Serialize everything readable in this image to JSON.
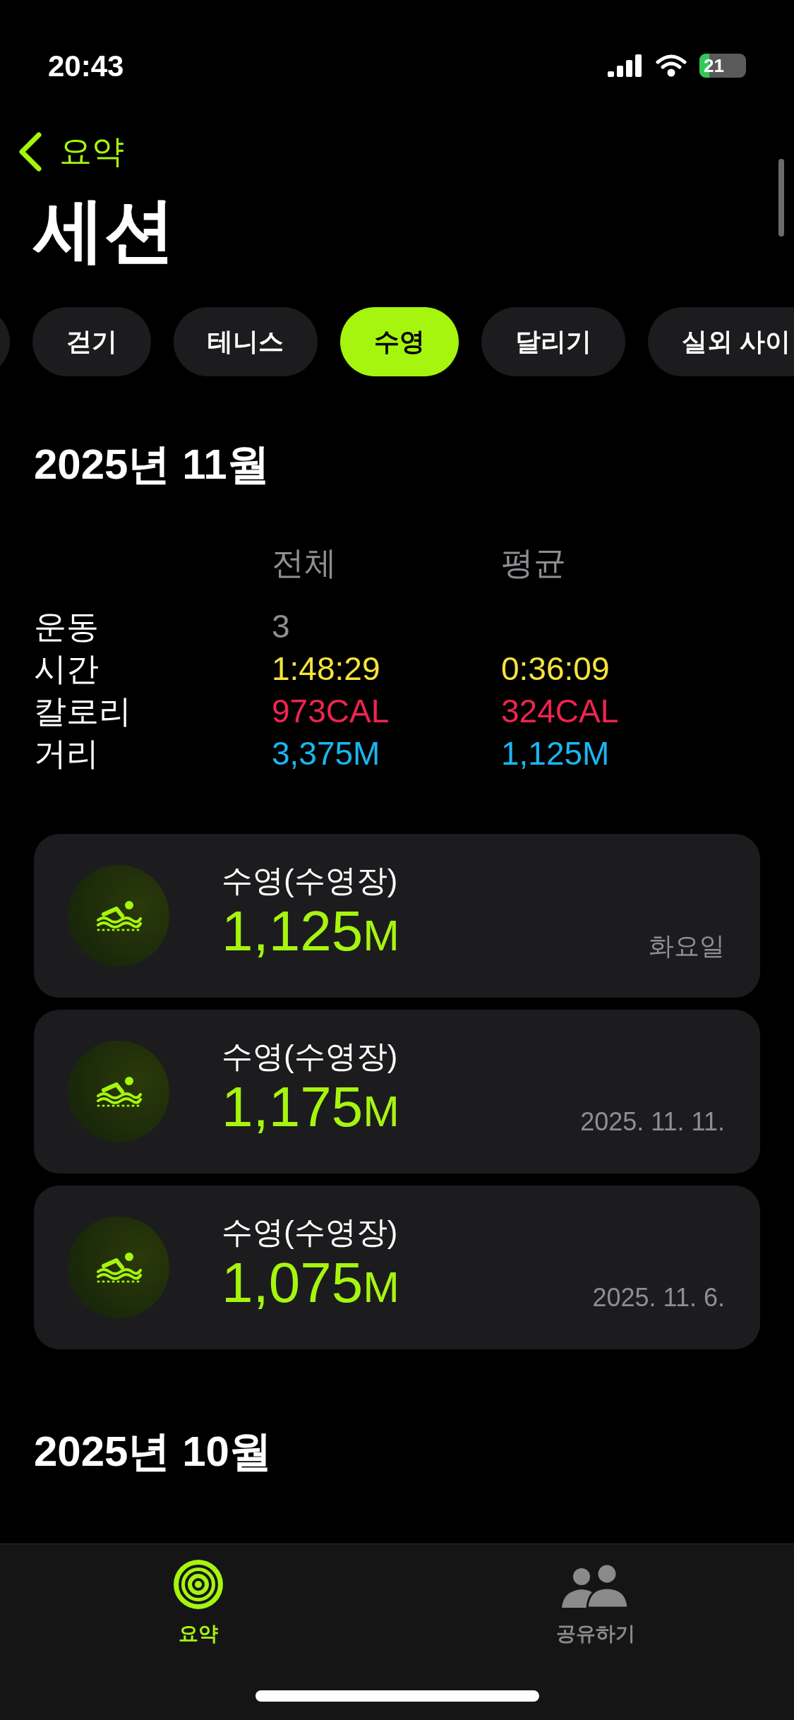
{
  "status_bar": {
    "time": "20:43",
    "battery": "21"
  },
  "nav": {
    "back_label": "요약",
    "title": "세션"
  },
  "filters": [
    {
      "selected": false
    },
    {
      "label": "걷기",
      "selected": false
    },
    {
      "label": "테니스",
      "selected": false
    },
    {
      "label": "수영",
      "selected": true
    },
    {
      "label": "달리기",
      "selected": false
    },
    {
      "label": "실외 사이",
      "selected": false
    }
  ],
  "sections": [
    {
      "title": "2025년 11월",
      "columns": [
        "전체",
        "평균"
      ],
      "rows": [
        {
          "label": "운동",
          "total": "3",
          "color": "#8e8e93"
        },
        {
          "label": "시간",
          "total": "1:48:29",
          "average": "0:36:09",
          "color": "#f5e33b"
        },
        {
          "label": "칼로리",
          "total": "973CAL",
          "average": "324CAL",
          "color": "#f0244f"
        },
        {
          "label": "거리",
          "total": "3,375M",
          "average": "1,125M",
          "color": "#1ab7f0"
        }
      ],
      "workouts": [
        {
          "title": "수영(수영장)",
          "value": "1,125",
          "unit": "M",
          "date": "화요일"
        },
        {
          "title": "수영(수영장)",
          "value": "1,175",
          "unit": "M",
          "date": "2025. 11. 11."
        },
        {
          "title": "수영(수영장)",
          "value": "1,075",
          "unit": "M",
          "date": "2025. 11. 6."
        }
      ]
    },
    {
      "title": "2025년 10월"
    }
  ],
  "tab_bar": [
    {
      "kind": "rings",
      "label": "요약",
      "selected": true
    },
    {
      "kind": "people",
      "label": "공유하기",
      "selected": false
    }
  ]
}
